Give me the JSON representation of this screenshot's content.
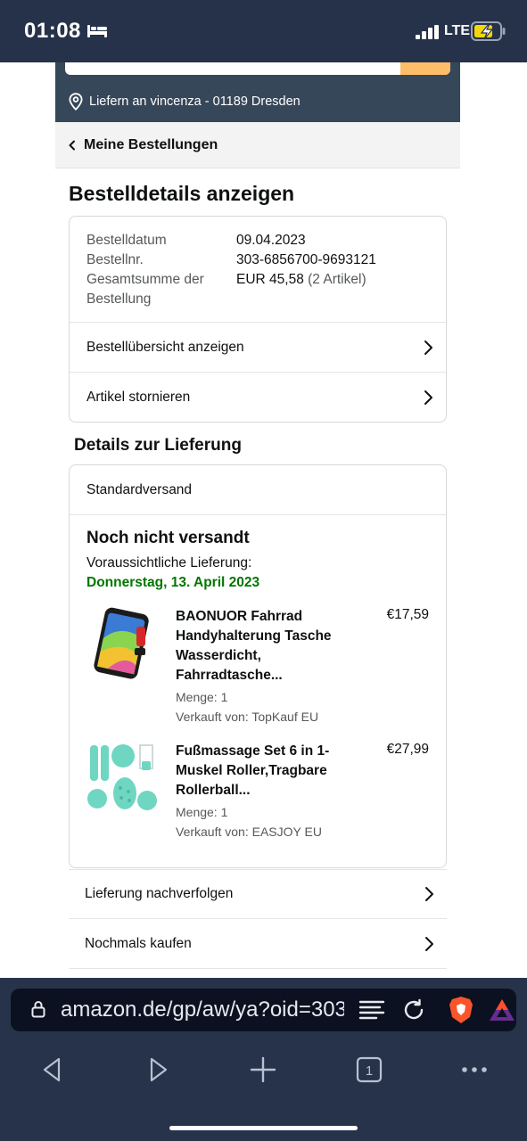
{
  "status_bar": {
    "time": "01:08",
    "network": "LTE"
  },
  "header": {
    "delivery_text": "Liefern an vincenza - 01189 Dresden",
    "accent_color": "#febd69",
    "header_color": "#37475a"
  },
  "breadcrumb": {
    "back_label": "Meine Bestellungen"
  },
  "page": {
    "title": "Bestelldetails anzeigen"
  },
  "order_info": {
    "rows": [
      {
        "key": "Bestelldatum",
        "value": "09.04.2023"
      },
      {
        "key": "Bestellnr.",
        "value": "303-6856700-9693121"
      },
      {
        "key": "Gesamtsumme der Bestellung",
        "value": "EUR 45,58",
        "extra": "(2 Artikel)"
      }
    ],
    "links": [
      {
        "label": "Bestellübersicht anzeigen"
      },
      {
        "label": "Artikel stornieren"
      }
    ]
  },
  "delivery": {
    "section_title": "Details zur Lieferung",
    "method": "Standardversand",
    "status": "Noch nicht versandt",
    "expected_label": "Voraussichtliche Lieferung:",
    "expected_date": "Donnerstag, 13. April 2023",
    "date_color": "#007600",
    "items": [
      {
        "icon": "phone-bike-bag-image",
        "title": "BAONUOR Fahrrad Handyhalterung Tasche Wasserdicht, Fahrradtasche...",
        "quantity": "Menge: 1",
        "seller": "Verkauft von: TopKauf EU",
        "price": "€17,59"
      },
      {
        "icon": "foot-massage-set-image",
        "title": "Fußmassage Set 6 in 1-Muskel Roller,Tragbare Rollerball...",
        "quantity": "Menge: 1",
        "seller": "Verkauft von: EASJOY EU",
        "price": "€27,99"
      }
    ]
  },
  "actions": [
    {
      "label": "Lieferung nachverfolgen"
    },
    {
      "label": "Nochmals kaufen"
    }
  ],
  "browser": {
    "url": "amazon.de/gp/aw/ya?oid=303",
    "tab_count": "1",
    "brave_color": "#fb542b"
  }
}
